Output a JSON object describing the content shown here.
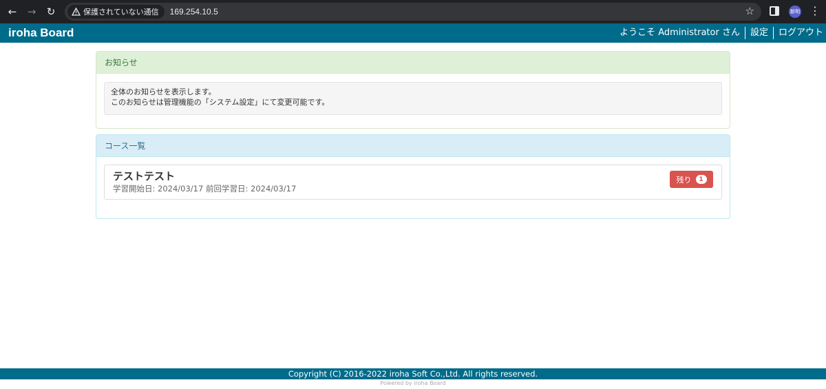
{
  "browser": {
    "security_label": "保護されていない通信",
    "url": "169.254.10.5",
    "profile_initials": "新明"
  },
  "header": {
    "brand": "iroha Board",
    "welcome": "ようこそ Administrator さん",
    "settings_link": "設定",
    "logout_link": "ログアウト"
  },
  "notice_panel": {
    "title": "お知らせ",
    "line1": "全体のお知らせを表示します。",
    "line2": "このお知らせは管理機能の「システム設定」にて変更可能です。"
  },
  "courses_panel": {
    "title": "コース一覧",
    "courses": [
      {
        "name": "テストテスト",
        "dates": "学習開始日: 2024/03/17 前回学習日: 2024/03/17",
        "remaining_label": "残り",
        "remaining_count": "1"
      }
    ]
  },
  "footer": {
    "copyright": "Copyright (C) 2016-2022 iroha Soft Co.,Ltd. All rights reserved.",
    "powered": "Powered by iroha Board"
  },
  "colors": {
    "header_bg": "#006b8a",
    "info_heading_bg": "#dff0d8",
    "courses_heading_bg": "#d9edf7",
    "remain_button": "#d9534f"
  }
}
